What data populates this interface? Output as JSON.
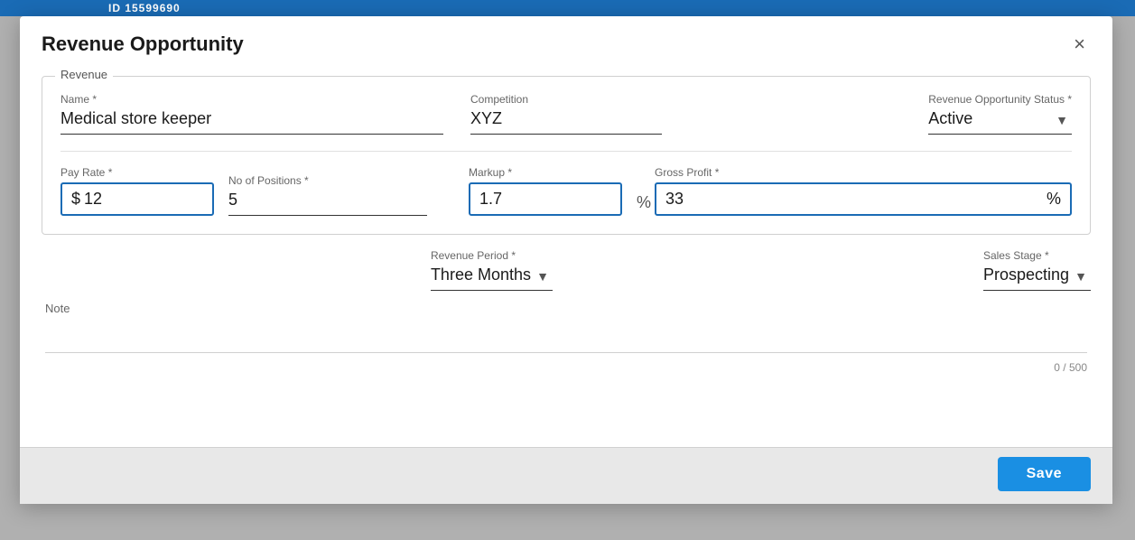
{
  "topbar": {
    "id_text": "ID 15599690"
  },
  "modal": {
    "title": "Revenue Opportunity",
    "close_label": "×"
  },
  "section": {
    "label": "Revenue"
  },
  "form": {
    "name_label": "Name *",
    "name_value": "Medical store keeper",
    "competition_label": "Competition",
    "competition_value": "XYZ",
    "status_label": "Revenue Opportunity Status *",
    "status_value": "Active",
    "pay_rate_label": "Pay Rate *",
    "pay_rate_prefix": "$",
    "pay_rate_value": "12",
    "positions_label": "No of Positions *",
    "positions_value": "5",
    "markup_label": "Markup *",
    "markup_value": "1.7",
    "markup_suffix": "",
    "gross_profit_label": "Gross Profit *",
    "gross_profit_prefix": "%",
    "gross_profit_value": "33",
    "gross_profit_suffix": "%",
    "revenue_period_label": "Revenue Period *",
    "revenue_period_value": "Three Months",
    "sales_stage_label": "Sales Stage *",
    "sales_stage_value": "Prospecting",
    "note_label": "Note",
    "note_value": "",
    "note_placeholder": "",
    "note_counter": "0 / 500"
  },
  "footer": {
    "save_label": "Save"
  }
}
